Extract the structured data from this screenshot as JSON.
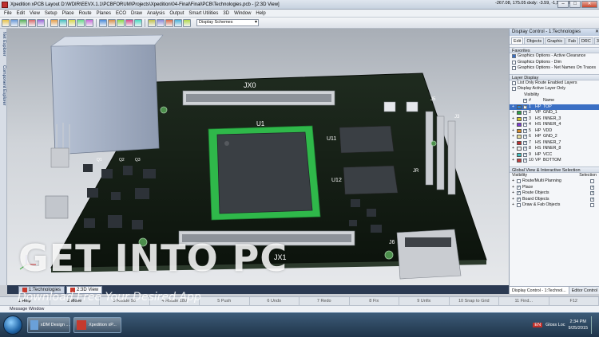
{
  "window": {
    "title": "Xpedition xPCB Layout  D:\\WDIR\\EEVX.1.1\\PCBFORUM\\Projects\\Xpedition\\04-Final\\Final\\PCB\\Technologies.pcb - [2:3D View]",
    "coords": "-267.08, 175.05 dxdy: -3.59, -1,505.82 th",
    "minimize": "–",
    "maximize": "□",
    "close": "✕"
  },
  "menu": [
    "File",
    "Edit",
    "View",
    "Setup",
    "Place",
    "Route",
    "Planes",
    "ECO",
    "Draw",
    "Analysis",
    "Output",
    "Smart Utilities",
    "3D",
    "Window",
    "Help"
  ],
  "toolbar": {
    "scheme": "Display Schemes"
  },
  "left_tabs": [
    "Net Explorer",
    "Component Explorer"
  ],
  "board": {
    "refs": [
      "JX0",
      "JX1",
      "U1",
      "U11",
      "U12",
      "J6",
      "Q1",
      "Q2",
      "Q3",
      "JR",
      "J3",
      "J5"
    ]
  },
  "doc_tabs": [
    {
      "label": "1:Technologies",
      "active": false
    },
    {
      "label": "2:3D View",
      "active": true
    }
  ],
  "panel": {
    "title": "Display Control - 1:Technologies",
    "tabs": [
      "Edit",
      "Objects",
      "Graphic",
      "Fab",
      "DRC",
      "3D"
    ],
    "favorites_header": "Favorites",
    "favorites": [
      {
        "label": "Graphics Options - Active Clearance",
        "checked": true
      },
      {
        "label": "Graphics Options - Dim",
        "checked": false
      },
      {
        "label": "Graphics Options - Net Names On Traces",
        "checked": false
      }
    ],
    "layer_header": "Layer Display",
    "layer_opts": [
      "List Only Route Enabled Layers",
      "Display Active Layer Only"
    ],
    "visibility_label": "Visibility",
    "layer_cols": {
      "num": "#",
      "name": "Name"
    },
    "layers": [
      {
        "num": "1",
        "type": "HP",
        "name": "TOP",
        "color": "#2a7fd4",
        "selected": true
      },
      {
        "num": "2",
        "type": "VP",
        "name": "GND_1",
        "color": "#2ea04a",
        "selected": false
      },
      {
        "num": "3",
        "type": "HS",
        "name": "INNER_3",
        "color": "#d4c42a",
        "selected": false
      },
      {
        "num": "4",
        "type": "HS",
        "name": "INNER_4",
        "color": "#7c3ad4",
        "selected": false
      },
      {
        "num": "5",
        "type": "HP",
        "name": "VDD",
        "color": "#d48a2a",
        "selected": false
      },
      {
        "num": "6",
        "type": "HP",
        "name": "GND_2",
        "color": "#e8e0a0",
        "selected": false
      },
      {
        "num": "7",
        "type": "HS",
        "name": "INNER_7",
        "color": "#c03030",
        "selected": false
      },
      {
        "num": "8",
        "type": "HS",
        "name": "INNER_8",
        "color": "#f0f0f0",
        "selected": false
      },
      {
        "num": "9",
        "type": "HP",
        "name": "VCC",
        "color": "#40c0c0",
        "selected": false
      },
      {
        "num": "10",
        "type": "VP",
        "name": "BOTTOM",
        "color": "#c04040",
        "selected": false
      }
    ],
    "global_header": "Global View & Interactive Selection",
    "global_cols": {
      "visibility": "Visibility",
      "selection": "Selection"
    },
    "global_items": [
      {
        "label": "Route/Multi Planning",
        "checked": false
      },
      {
        "label": "Place",
        "checked": true
      },
      {
        "label": "Route Objects",
        "checked": true
      },
      {
        "label": "Board Objects",
        "checked": true
      },
      {
        "label": "Draw & Fab Objects",
        "checked": false
      }
    ],
    "bottom_tabs": [
      {
        "label": "Display Control - 1:Technol...",
        "active": true
      },
      {
        "label": "Editor Control",
        "active": false
      }
    ]
  },
  "fkeys": [
    "1 Help",
    "2 Move",
    "3 Rotate 90",
    "4 Rotate 180",
    "5 Push",
    "6 Undo",
    "7 Redo",
    "8 Fix",
    "9 Unfix",
    "10 Snap to Grid",
    "11 Find...",
    "F12"
  ],
  "message_window": "Message Window",
  "taskbar": {
    "buttons": [
      {
        "label": "xDM Design ..."
      },
      {
        "label": "Xpedition xP..."
      }
    ],
    "tray": {
      "lang": "EN",
      "status": "Gloss Loc",
      "time": "2:34 PM",
      "date": "9/25/2015"
    }
  },
  "watermark": {
    "big": "GET INTO PC",
    "small": "Download Free Your Desired App"
  }
}
